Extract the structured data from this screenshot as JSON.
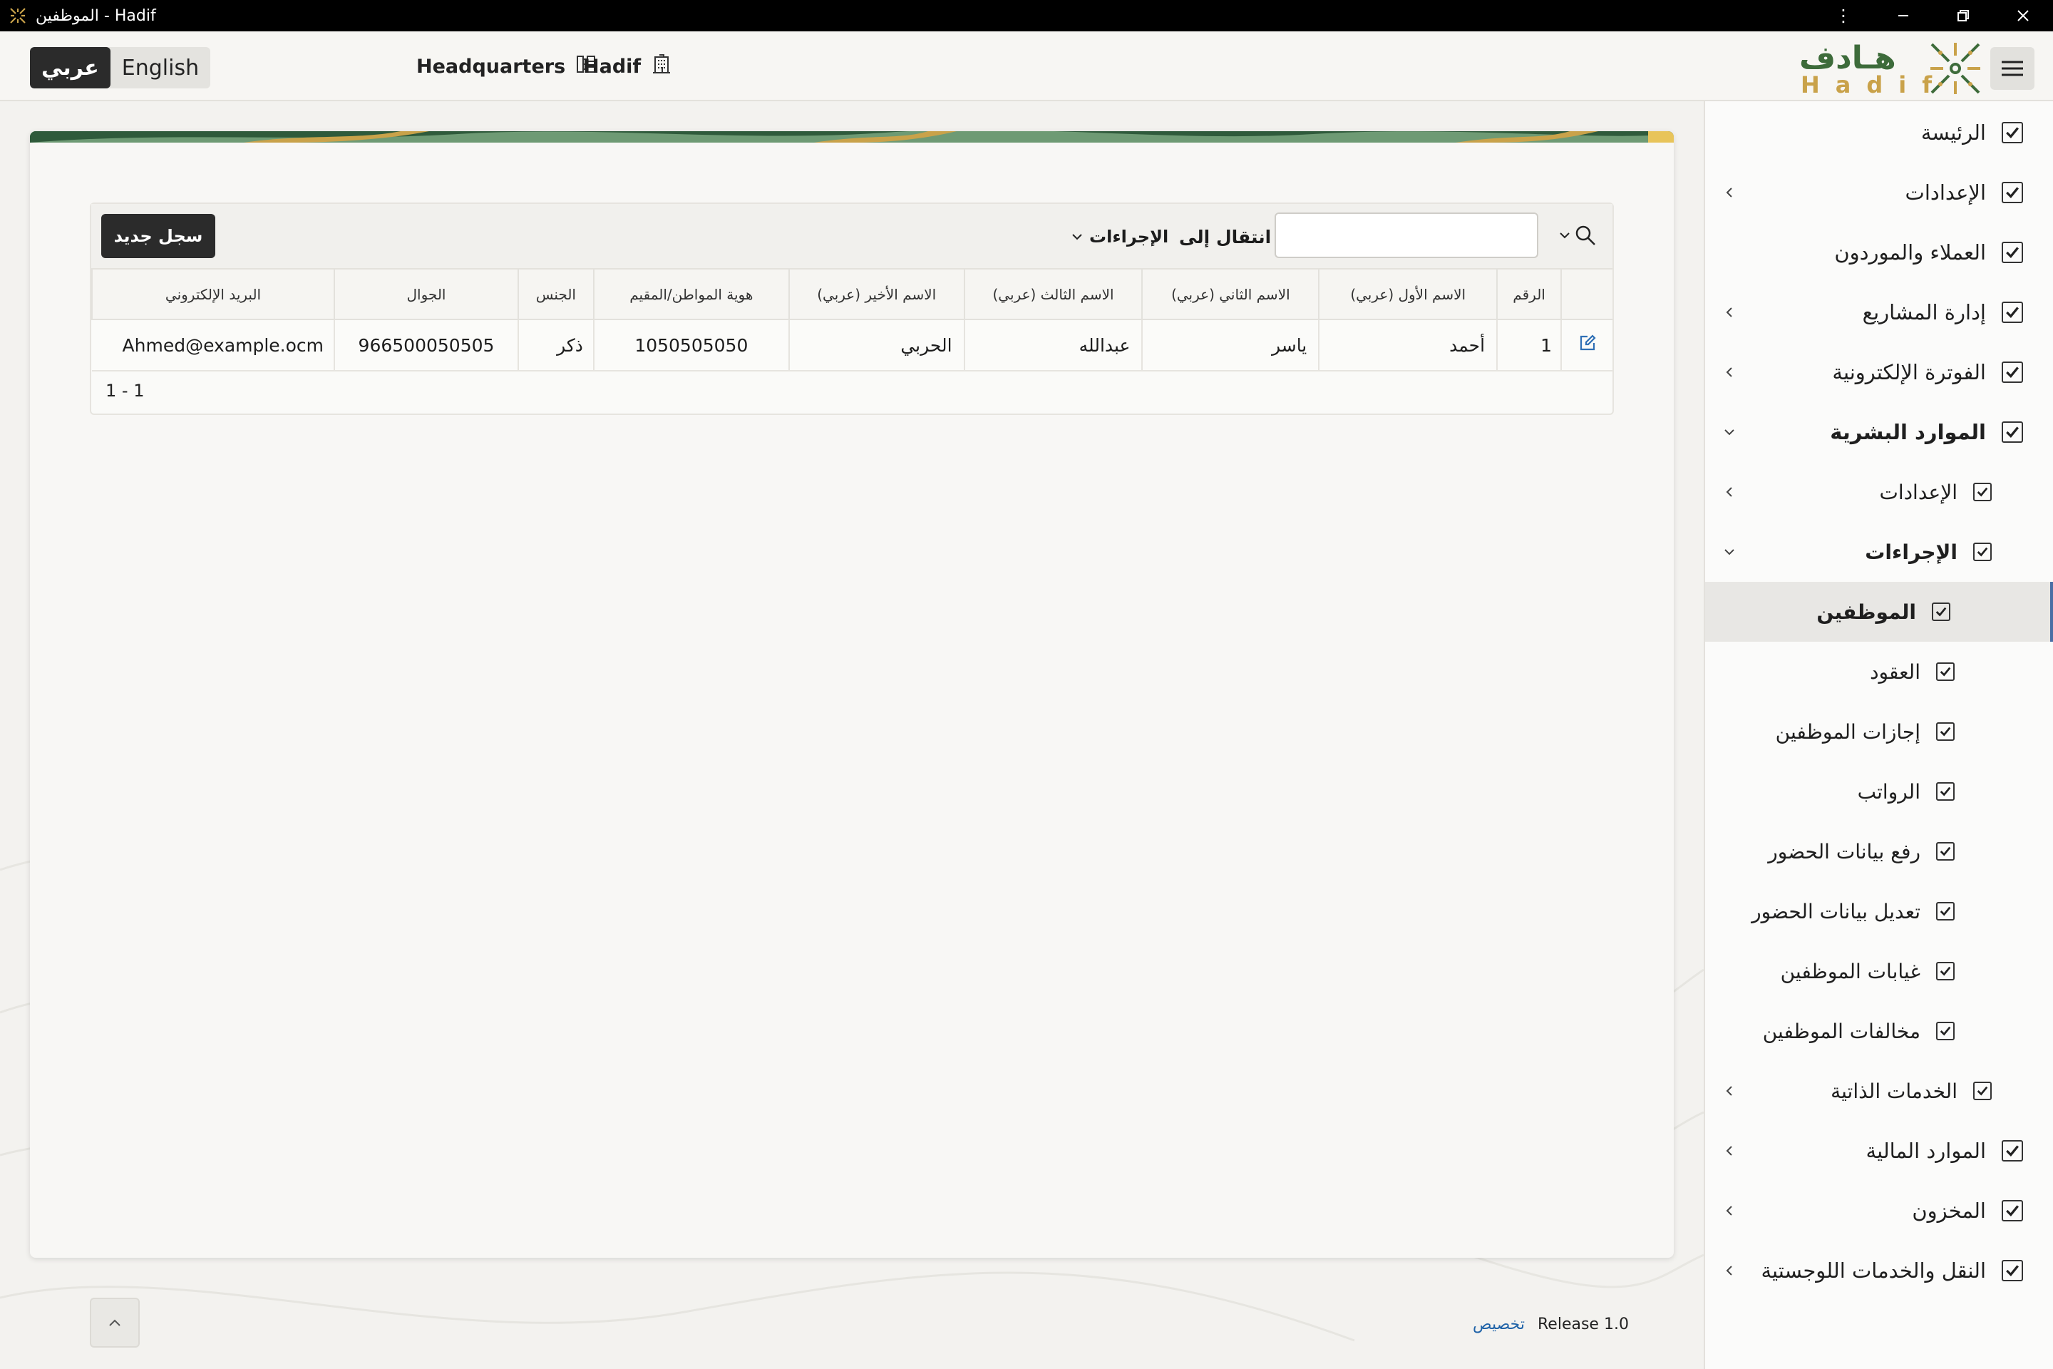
{
  "window": {
    "title": "الموظفين - Hadif",
    "controls": [
      "more-vertical-icon",
      "minimize-icon",
      "restore-icon",
      "close-icon"
    ]
  },
  "header": {
    "languages": {
      "active": "عربي",
      "inactive": "English"
    },
    "location": "Headquarters",
    "organization": "Hadif",
    "logo_ar": "هـادف",
    "logo_en": "Hadif"
  },
  "toolbar": {
    "new_button": "سجل جديد",
    "actions_label": "الإجراءات",
    "goto_label": "انتقال إلى",
    "search_value": ""
  },
  "table": {
    "columns": [
      "الرقم",
      "الاسم الأول (عربي)",
      "الاسم الثاني (عربي)",
      "الاسم الثالث (عربي)",
      "الاسم الأخير (عربي)",
      "هوية المواطن/المقيم",
      "الجنس",
      "الجوال",
      "البريد الإلكتروني"
    ],
    "rows": [
      [
        "1",
        "أحمد",
        "ياسر",
        "عبدالله",
        "الحربي",
        "1050505050",
        "ذكر",
        "966500050505",
        "Ahmed@example.ocm"
      ]
    ],
    "pagination": "1 - 1"
  },
  "footer": {
    "customize": "تخصيص",
    "release": "Release 1.0"
  },
  "sidebar": {
    "items": [
      {
        "label": "الرئيسة",
        "level": 0,
        "chevron": "none",
        "active": false,
        "bold": false
      },
      {
        "label": "الإعدادات",
        "level": 0,
        "chevron": "left",
        "active": false,
        "bold": false
      },
      {
        "label": "العملاء والموردون",
        "level": 0,
        "chevron": "none",
        "active": false,
        "bold": false
      },
      {
        "label": "إدارة المشاريع",
        "level": 0,
        "chevron": "left",
        "active": false,
        "bold": false
      },
      {
        "label": "الفوترة الإلكترونية",
        "level": 0,
        "chevron": "left",
        "active": false,
        "bold": false
      },
      {
        "label": "الموارد البشرية",
        "level": 0,
        "chevron": "down",
        "active": false,
        "bold": true
      },
      {
        "label": "الإعدادات",
        "level": 1,
        "chevron": "left",
        "active": false,
        "bold": false
      },
      {
        "label": "الإجراءات",
        "level": 1,
        "chevron": "down",
        "active": false,
        "bold": true
      },
      {
        "label": "الموظفين",
        "level": 2,
        "chevron": "none",
        "active": true,
        "bold": true
      },
      {
        "label": "العقود",
        "level": 2,
        "chevron": "none",
        "active": false,
        "bold": false
      },
      {
        "label": "إجازات الموظفين",
        "level": 2,
        "chevron": "none",
        "active": false,
        "bold": false
      },
      {
        "label": "الرواتب",
        "level": 2,
        "chevron": "none",
        "active": false,
        "bold": false
      },
      {
        "label": "رفع بيانات الحضور",
        "level": 2,
        "chevron": "none",
        "active": false,
        "bold": false
      },
      {
        "label": "تعديل بيانات الحضور",
        "level": 2,
        "chevron": "none",
        "active": false,
        "bold": false
      },
      {
        "label": "غيابات الموظفين",
        "level": 2,
        "chevron": "none",
        "active": false,
        "bold": false
      },
      {
        "label": "مخالفات الموظفين",
        "level": 2,
        "chevron": "none",
        "active": false,
        "bold": false
      },
      {
        "label": "الخدمات الذاتية",
        "level": 1,
        "chevron": "left",
        "active": false,
        "bold": false
      },
      {
        "label": "الموارد المالية",
        "level": 0,
        "chevron": "left",
        "active": false,
        "bold": false
      },
      {
        "label": "المخزون",
        "level": 0,
        "chevron": "left",
        "active": false,
        "bold": false
      },
      {
        "label": "النقل والخدمات اللوجستية",
        "level": 0,
        "chevron": "left",
        "active": false,
        "bold": false
      }
    ]
  },
  "colors": {
    "accent": "#4a6fa5",
    "logo_green": "#3d6b3a",
    "logo_gold": "#c9a24a",
    "dark_button": "#2b2b2b",
    "link": "#1f63a8"
  }
}
